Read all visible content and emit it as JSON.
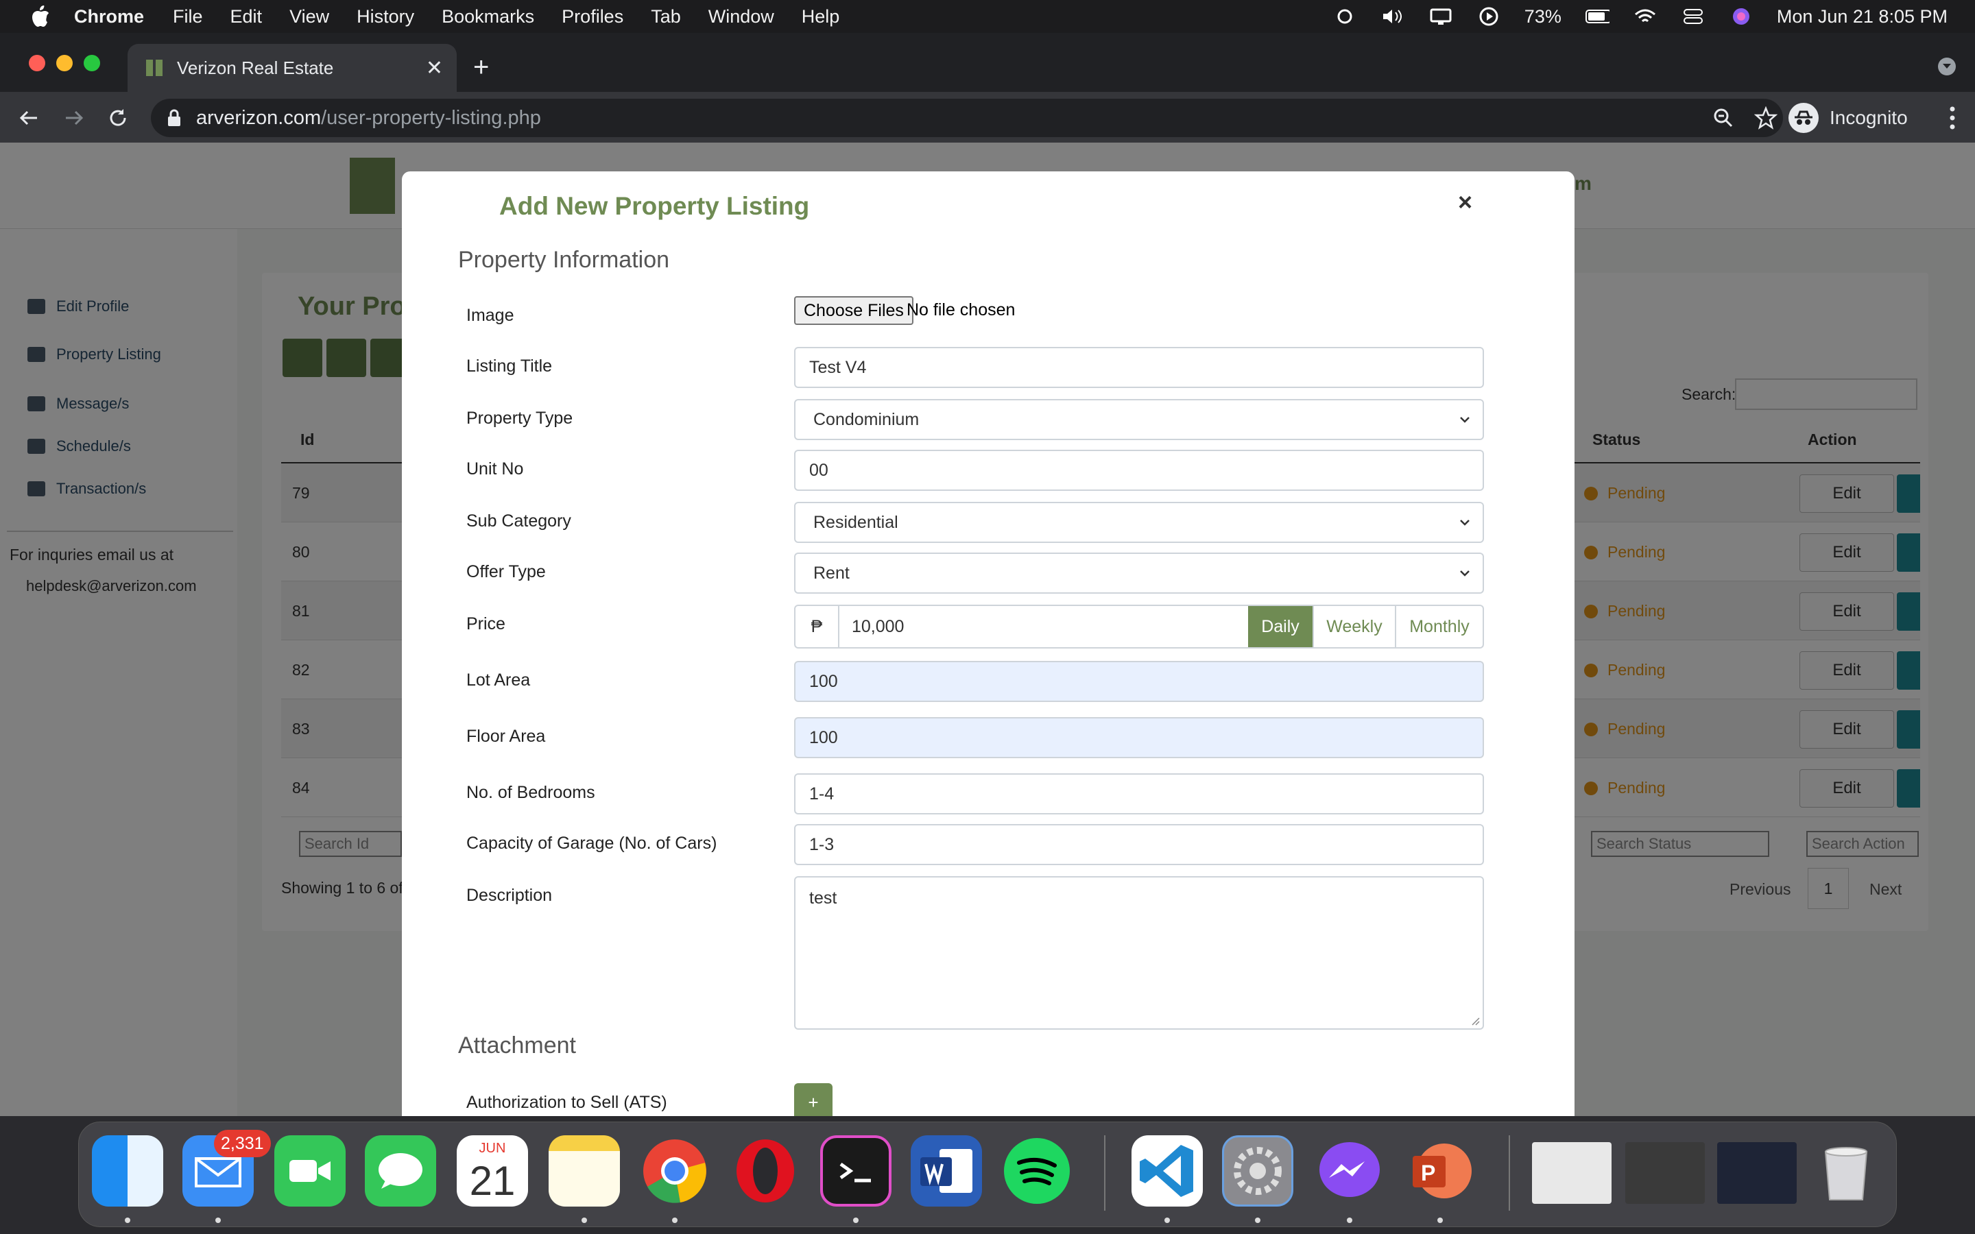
{
  "menubar": {
    "app_name": "Chrome",
    "items": [
      "File",
      "Edit",
      "View",
      "History",
      "Bookmarks",
      "Profiles",
      "Tab",
      "Window",
      "Help"
    ],
    "battery": "73%",
    "datetime": "Mon Jun 21  8:05 PM"
  },
  "browser": {
    "tab_title": "Verizon Real Estate",
    "url_host": "arverizon.com",
    "url_path": "/user-property-listing.php",
    "profile": "Incognito"
  },
  "page": {
    "sidebar": [
      "Edit Profile",
      "Property Listing",
      "Message/s",
      "Schedule/s",
      "Transaction/s"
    ],
    "contact_note": "For inquries email us at",
    "contact_email": "helpdesk@arverizon.com",
    "card_title": "Your Pro",
    "search_label": "Search:",
    "columns": {
      "id": "Id",
      "status": "Status",
      "action": "Action"
    },
    "rows": [
      {
        "id": "79",
        "status": "Pending",
        "action": "Edit"
      },
      {
        "id": "80",
        "status": "Pending",
        "action": "Edit"
      },
      {
        "id": "81",
        "status": "Pending",
        "action": "Edit"
      },
      {
        "id": "82",
        "status": "Pending",
        "action": "Edit"
      },
      {
        "id": "83",
        "status": "Pending",
        "action": "Edit"
      },
      {
        "id": "84",
        "status": "Pending",
        "action": "Edit"
      }
    ],
    "foot_search": {
      "id": "Search Id",
      "status": "Search Status",
      "action": "Search Action"
    },
    "showing": "Showing 1 to 6 of",
    "pager": {
      "previous": "Previous",
      "current": "1",
      "next": "Next"
    },
    "user_menu": "m"
  },
  "modal": {
    "title": "Add New Property Listing",
    "close": "×",
    "section_info": "Property Information",
    "section_attachment": "Attachment",
    "fields": {
      "image_label": "Image",
      "image_button": "Choose Files",
      "image_status": "No file chosen",
      "title_label": "Listing Title",
      "title_value": "Test V4",
      "type_label": "Property Type",
      "type_value": "Condominium",
      "unit_label": "Unit No",
      "unit_value": "00",
      "subcat_label": "Sub Category",
      "subcat_value": "Residential",
      "offer_label": "Offer Type",
      "offer_value": "Rent",
      "price_label": "Price",
      "price_currency": "₱",
      "price_value": "10,000",
      "price_daily": "Daily",
      "price_weekly": "Weekly",
      "price_monthly": "Monthly",
      "lot_label": "Lot Area",
      "lot_value": "100",
      "floor_label": "Floor Area",
      "floor_value": "100",
      "bedrooms_label": "No. of Bedrooms",
      "bedrooms_value": "1-4",
      "garage_label": "Capacity of Garage (No. of Cars)",
      "garage_value": "1-3",
      "desc_label": "Description",
      "desc_value": "test",
      "ats_label": "Authorization to Sell (ATS)",
      "ats_add": "+"
    }
  },
  "dock": {
    "mail_badge": "2,331",
    "calendar_month": "JUN",
    "calendar_day": "21"
  },
  "colors": {
    "brand_green": "#6f8b53",
    "pending_orange": "#e39418",
    "teal": "#1f8a97",
    "autofill_blue": "#e8f0fe"
  }
}
